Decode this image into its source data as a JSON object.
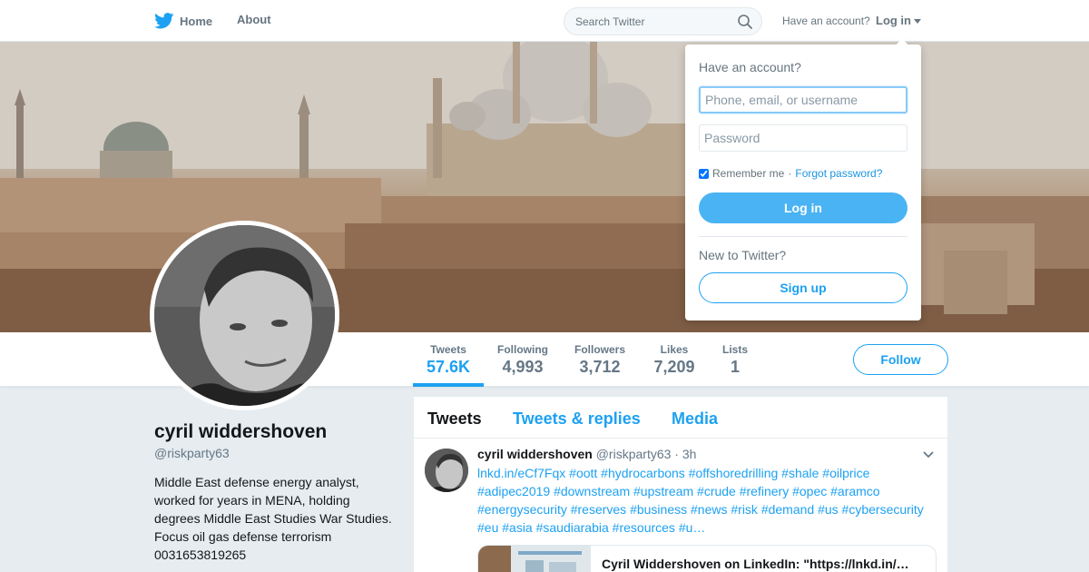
{
  "nav": {
    "home_label": "Home",
    "about_label": "About",
    "search_placeholder": "Search Twitter",
    "have_account": "Have an account?",
    "login_label": "Log in"
  },
  "profile": {
    "name": "cyril widdershoven",
    "handle": "@riskparty63",
    "bio": "Middle East defense energy analyst, worked for years in MENA, holding degrees Middle East Studies War Studies. Focus oil gas defense terrorism 0031653819265",
    "follow_label": "Follow",
    "stats": [
      {
        "label": "Tweets",
        "value": "57.6K"
      },
      {
        "label": "Following",
        "value": "4,993"
      },
      {
        "label": "Followers",
        "value": "3,712"
      },
      {
        "label": "Likes",
        "value": "7,209"
      },
      {
        "label": "Lists",
        "value": "1"
      }
    ]
  },
  "timeline": {
    "tabs": [
      "Tweets",
      "Tweets & replies",
      "Media"
    ],
    "tweet": {
      "name": "cyril widdershoven",
      "handle": "@riskparty63",
      "separator": "·",
      "time": "3h",
      "text": "lnkd.in/eCf7Fqx #oott #hydrocarbons #offshoredrilling #shale #oilprice #adipec2019 #downstream #upstream #crude #refinery #opec #aramco #energysecurity #reserves #business #news #risk #demand #us #cybersecurity #eu #asia #saudiarabia #resources #u…",
      "card_title": "Cyril Widdershoven on LinkedIn: \"https://lnkd.in/…"
    }
  },
  "login_dropdown": {
    "heading": "Have an account?",
    "username_placeholder": "Phone, email, or username",
    "password_placeholder": "Password",
    "remember_label": "Remember me",
    "dot": "·",
    "forgot_label": "Forgot password?",
    "login_button": "Log in",
    "new_heading": "New to Twitter?",
    "signup_button": "Sign up"
  },
  "colors": {
    "brand_blue": "#1da1f2",
    "login_button": "#4ab3f4",
    "background": "#e6ecf0"
  },
  "icons": [
    "twitter-bird-icon",
    "search-icon",
    "caret-down-icon",
    "chevron-down-icon"
  ]
}
